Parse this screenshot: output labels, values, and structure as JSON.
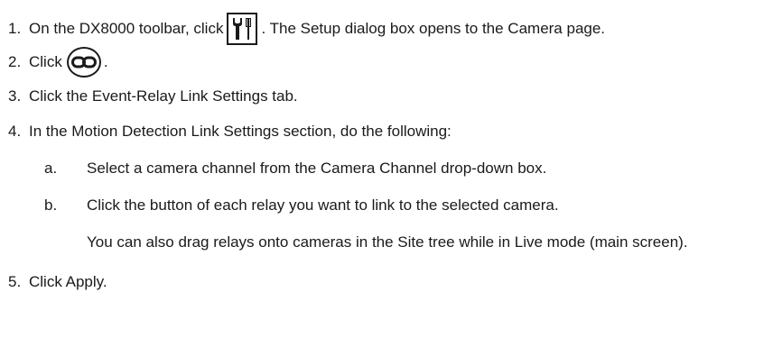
{
  "steps": [
    {
      "num": "1.",
      "before": "On the DX8000 toolbar, click",
      "icon": "setup-tools-icon",
      "after": ". The Setup dialog box opens to the Camera page."
    },
    {
      "num": "2.",
      "before": "Click",
      "icon": "link-chain-icon",
      "after": "."
    },
    {
      "num": "3.",
      "text": "Click the Event-Relay Link Settings tab."
    },
    {
      "num": "4.",
      "text": "In the Motion Detection Link Settings section, do the following:"
    },
    {
      "num": "5.",
      "text": "Click Apply."
    }
  ],
  "substeps": [
    {
      "letter": "a.",
      "text": "Select a camera channel from the Camera Channel drop-down box."
    },
    {
      "letter": "b.",
      "text": "Click the button of each relay you want to link to the selected camera.",
      "note": "You can also drag relays onto cameras in the Site tree while in Live mode (main screen)."
    }
  ]
}
